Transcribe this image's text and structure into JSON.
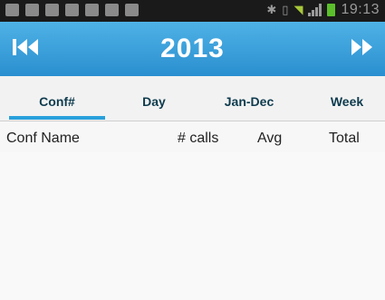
{
  "status_bar": {
    "time": "19:13",
    "left_icons": [
      "notification-icon",
      "notification-icon",
      "notification-icon",
      "notification-icon",
      "notification-icon",
      "usb-icon",
      "sync-icon"
    ],
    "right_icons": [
      "bluetooth-icon",
      "vibrate-icon",
      "wifi-icon",
      "signal-icon",
      "battery-icon"
    ]
  },
  "header": {
    "year": "2013",
    "prev_icon": "skip-previous-icon",
    "next_icon": "fast-forward-icon"
  },
  "tabs": [
    {
      "label": "Conf#",
      "active": true
    },
    {
      "label": "Day",
      "active": false
    },
    {
      "label": "Jan-Dec",
      "active": false
    },
    {
      "label": "Week",
      "active": false
    }
  ],
  "table": {
    "columns": [
      "Conf Name",
      "# calls",
      "Avg",
      "Total"
    ],
    "rows": []
  },
  "colors": {
    "header_top": "#4fb2e6",
    "header_bottom": "#2a8fcf",
    "tab_text": "#0e3b4e",
    "tab_indicator": "#2aa0dc",
    "background": "#f7f7f7"
  }
}
